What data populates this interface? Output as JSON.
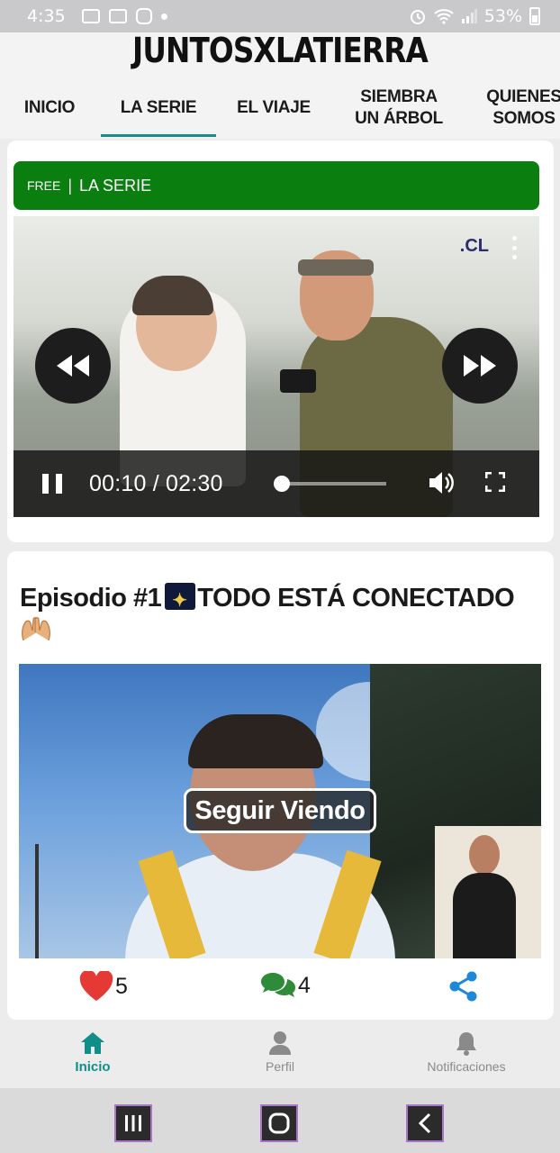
{
  "status_bar": {
    "time": "4:35",
    "battery": "53%"
  },
  "header": {
    "brand": "JUNTOSXLATIERRA"
  },
  "nav": {
    "items": [
      {
        "label": "INICIO",
        "active": false
      },
      {
        "label": "LA SERIE",
        "active": true
      },
      {
        "label": "EL VIAJE",
        "active": false
      },
      {
        "label": "SIEMBRA\nUN ÁRBOL",
        "active": false
      },
      {
        "label": "QUIENES\nSOMOS",
        "active": false
      }
    ]
  },
  "featured": {
    "badge_free": "FREE",
    "badge_sep": "|",
    "badge_label": "LA SERIE",
    "channel_logo": ".CL",
    "video": {
      "current_time": "00:10",
      "duration": "02:30",
      "time_display": "00:10 / 02:30",
      "progress": 0.067
    }
  },
  "episode": {
    "title": "Episodio #1",
    "title_rest": "TODO ESTÁ CONECTADO",
    "cta": "Seguir Viendo",
    "likes": "5",
    "comments": "4"
  },
  "tabs": [
    {
      "label": "Inicio",
      "icon": "home-icon",
      "active": true
    },
    {
      "label": "Perfil",
      "icon": "person-icon",
      "active": false
    },
    {
      "label": "Notificaciones",
      "icon": "bell-icon",
      "active": false
    }
  ],
  "colors": {
    "accent": "#0f8f88",
    "badge_green": "#0a7f0f",
    "heart": "#e53935",
    "comment": "#2e8b3a",
    "share": "#1e88d8"
  }
}
